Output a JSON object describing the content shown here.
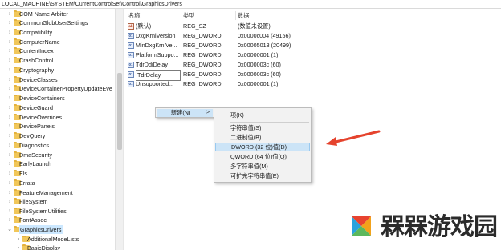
{
  "address_bar": {
    "path": "LOCAL_MACHINE\\SYSTEM\\CurrentControlSet\\Control\\GraphicsDrivers"
  },
  "tree": {
    "items": [
      {
        "label": "COM Name Arbiter"
      },
      {
        "label": "CommonGlobUserSettings"
      },
      {
        "label": "Compatibility"
      },
      {
        "label": "ComputerName"
      },
      {
        "label": "ContentIndex"
      },
      {
        "label": "CrashControl"
      },
      {
        "label": "Cryptography"
      },
      {
        "label": "DeviceClasses"
      },
      {
        "label": "DeviceContainerPropertyUpdateEve"
      },
      {
        "label": "DeviceContainers"
      },
      {
        "label": "DeviceGuard"
      },
      {
        "label": "DeviceOverrides"
      },
      {
        "label": "DevicePanels"
      },
      {
        "label": "DevQuery"
      },
      {
        "label": "Diagnostics"
      },
      {
        "label": "DmaSecurity"
      },
      {
        "label": "EarlyLaunch"
      },
      {
        "label": "Els"
      },
      {
        "label": "Errata"
      },
      {
        "label": "FeatureManagement"
      },
      {
        "label": "FileSystem"
      },
      {
        "label": "FileSystemUtilities"
      },
      {
        "label": "FontAssoc"
      },
      {
        "label": "GraphicsDrivers"
      }
    ],
    "children": [
      {
        "label": "AdditionalModeLists"
      },
      {
        "label": "BasicDisplay"
      }
    ]
  },
  "columns": {
    "name": "名称",
    "type": "类型",
    "data": "数据"
  },
  "values": [
    {
      "name": "(默认)",
      "type": "REG_SZ",
      "data": "(数值未设置)",
      "icon": "string-value-icon"
    },
    {
      "name": "DxgKrnlVersion",
      "type": "REG_DWORD",
      "data": "0x0000c004 (49156)",
      "icon": "dword-value-icon"
    },
    {
      "name": "MinDxgKrnlVe...",
      "type": "REG_DWORD",
      "data": "0x00005013 (20499)",
      "icon": "dword-value-icon"
    },
    {
      "name": "PlatformSuppo...",
      "type": "REG_DWORD",
      "data": "0x00000001 (1)",
      "icon": "dword-value-icon"
    },
    {
      "name": "TdrDdiDelay",
      "type": "REG_DWORD",
      "data": "0x0000003c (60)",
      "icon": "dword-value-icon"
    },
    {
      "name": "TdrDelay",
      "type": "REG_DWORD",
      "data": "0x0000003c (60)",
      "icon": "dword-value-icon"
    },
    {
      "name": "Unsupported...",
      "type": "REG_DWORD",
      "data": "0x00000001 (1)",
      "icon": "dword-value-icon"
    }
  ],
  "context_menu": {
    "new_label": "新建(N)",
    "new_arrow": ">"
  },
  "submenu": {
    "key": "项(K)",
    "string": "字符串值(S)",
    "binary": "二进制值(B)",
    "dword": "DWORD (32 位)值(D)",
    "qword": "QWORD (64 位)值(Q)",
    "multi_string": "多字符串值(M)",
    "expandable_string": "可扩充字符串值(E)"
  },
  "watermark": {
    "text": "槑槑游戏园"
  },
  "colors": {
    "selection": "#cce4f7",
    "annotation_arrow": "#e5432d",
    "folder": "#f1c75a"
  }
}
